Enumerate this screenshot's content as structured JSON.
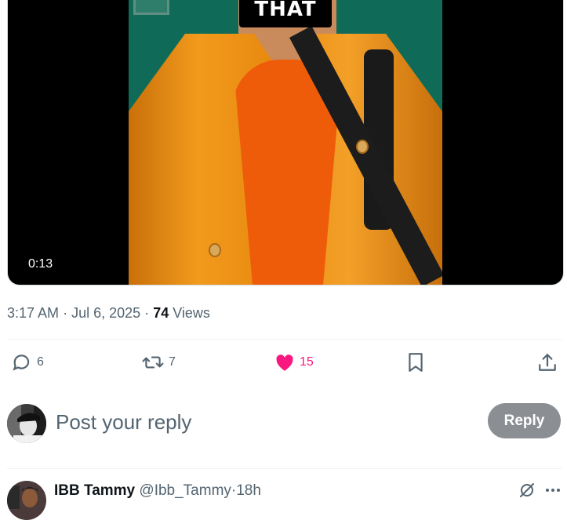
{
  "video": {
    "caption": "THAT",
    "duration": "0:13"
  },
  "post_meta": {
    "time": "3:17 AM",
    "date": "Jul 6, 2025",
    "separator": "·",
    "views_count": "74",
    "views_label": "Views"
  },
  "actions": {
    "replies": "6",
    "reposts": "7",
    "likes": "15",
    "like_color": "#f91880"
  },
  "composer": {
    "placeholder": "Post your reply",
    "reply_button": "Reply"
  },
  "next_reply": {
    "display_name": "IBB Tammy",
    "handle": "@Ibb_Tammy",
    "separator": "·",
    "time": "18h"
  },
  "colors": {
    "muted": "#536471",
    "reply_button_bg": "#8b8f93",
    "divider": "#eff3f4"
  }
}
